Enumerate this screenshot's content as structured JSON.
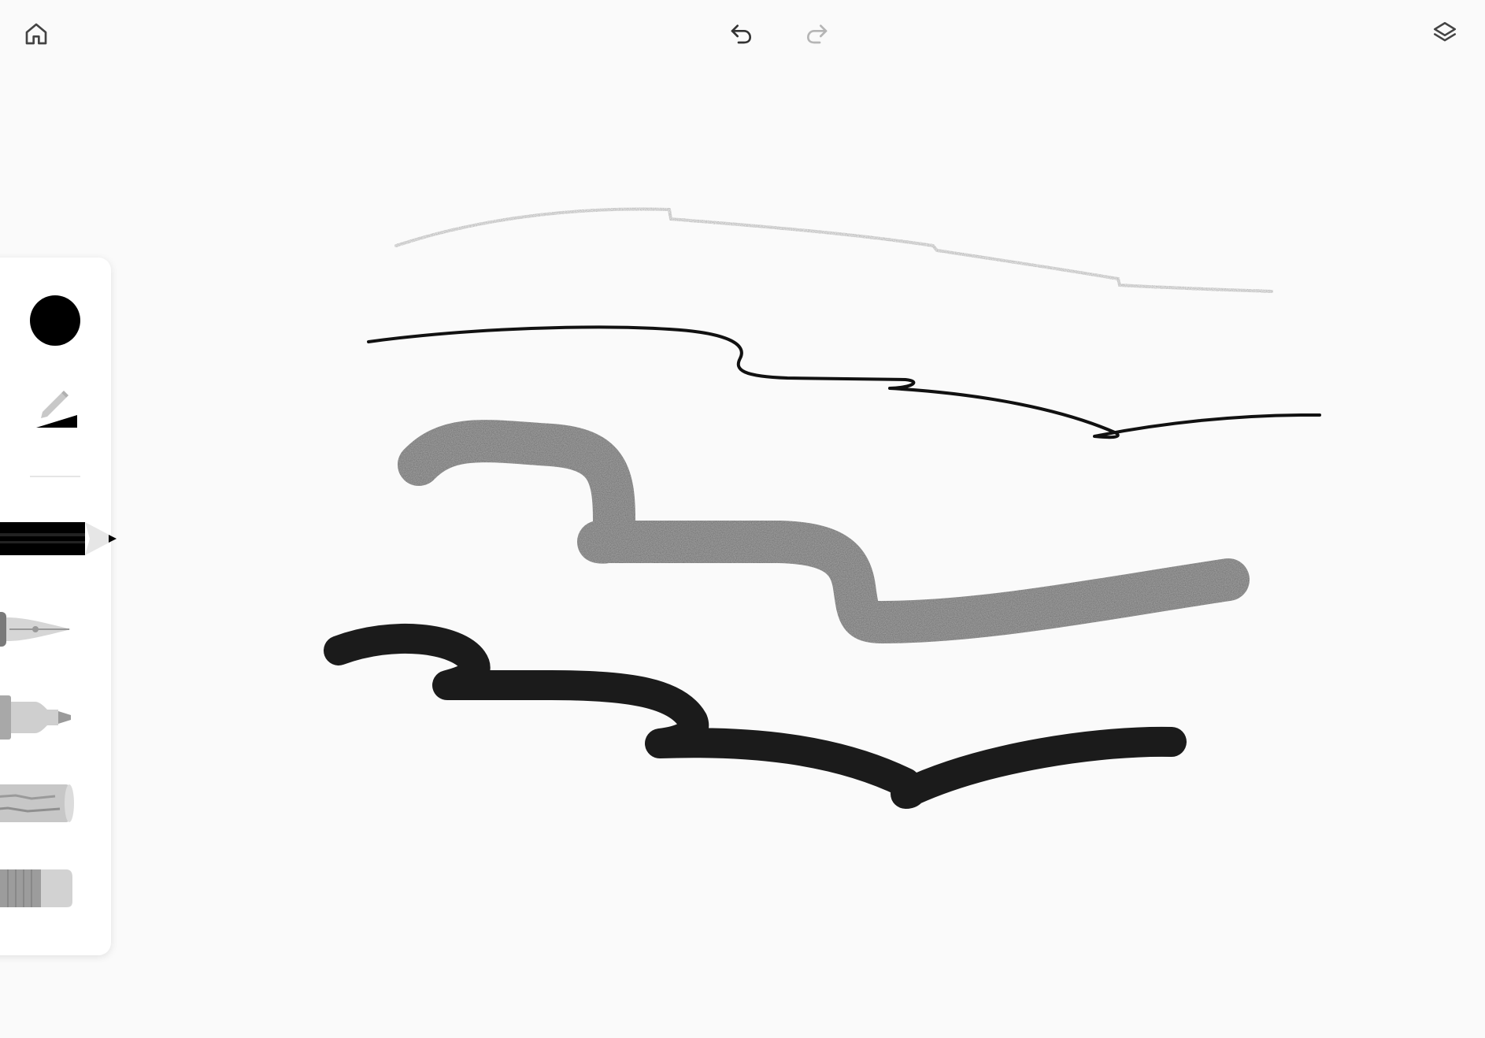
{
  "topbar": {
    "home_icon": "home-icon",
    "undo_icon": "undo-icon",
    "redo_icon": "redo-icon",
    "layers_icon": "layers-icon",
    "redo_enabled": false
  },
  "toolbar": {
    "selected_color": "#000000",
    "size_icon": "pencil-size-icon",
    "tools": [
      {
        "name": "pencil",
        "icon": "pencil-icon",
        "selected": true
      },
      {
        "name": "pen",
        "icon": "fountain-pen-icon",
        "selected": false
      },
      {
        "name": "marker",
        "icon": "marker-icon",
        "selected": false
      },
      {
        "name": "chalk",
        "icon": "chalk-icon",
        "selected": false
      },
      {
        "name": "eraser",
        "icon": "eraser-icon",
        "selected": false
      }
    ]
  },
  "canvas": {
    "strokes": [
      {
        "tool": "pencil",
        "color": "#b0b0b0",
        "style": "thin textured"
      },
      {
        "tool": "pen",
        "color": "#000000",
        "style": "thin ink"
      },
      {
        "tool": "chalk",
        "color": "#9a9a9a",
        "style": "wide textured"
      },
      {
        "tool": "marker",
        "color": "#1a1a1a",
        "style": "wide solid"
      }
    ]
  }
}
